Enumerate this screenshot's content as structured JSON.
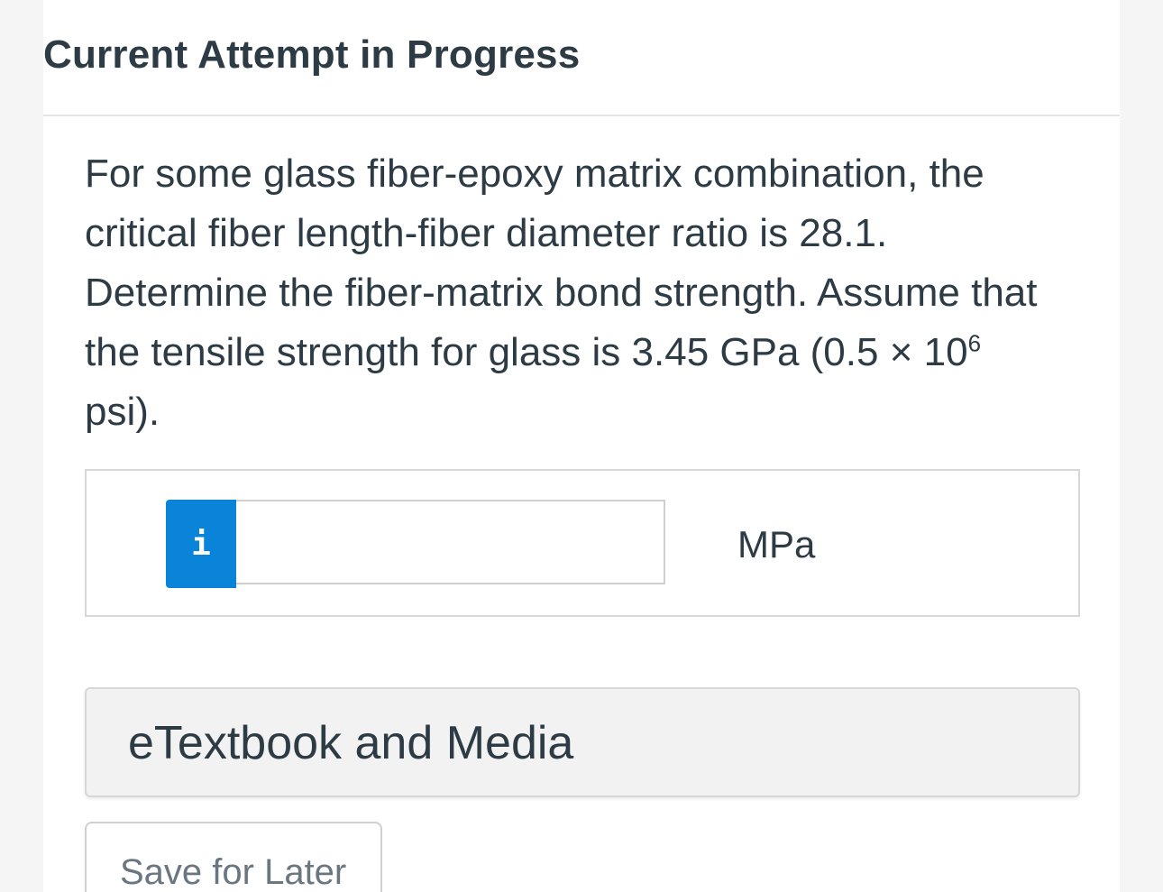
{
  "header": {
    "title": "Current Attempt in Progress"
  },
  "question": {
    "text_main": "For some glass fiber-epoxy matrix combination, the critical fiber length-fiber diameter ratio is 28.1. Determine the fiber-matrix bond strength. Assume that the tensile strength for glass is 3.45 GPa (0.5 × 10",
    "exponent": "6",
    "text_tail": " psi)."
  },
  "answer": {
    "info_label": "i",
    "value": "",
    "unit": "MPa"
  },
  "media": {
    "label": "eTextbook and Media"
  },
  "actions": {
    "save_label": "Save for Later"
  },
  "colors": {
    "accent": "#0a84d8",
    "text": "#2d3b45",
    "background": "#f5f5f5"
  }
}
